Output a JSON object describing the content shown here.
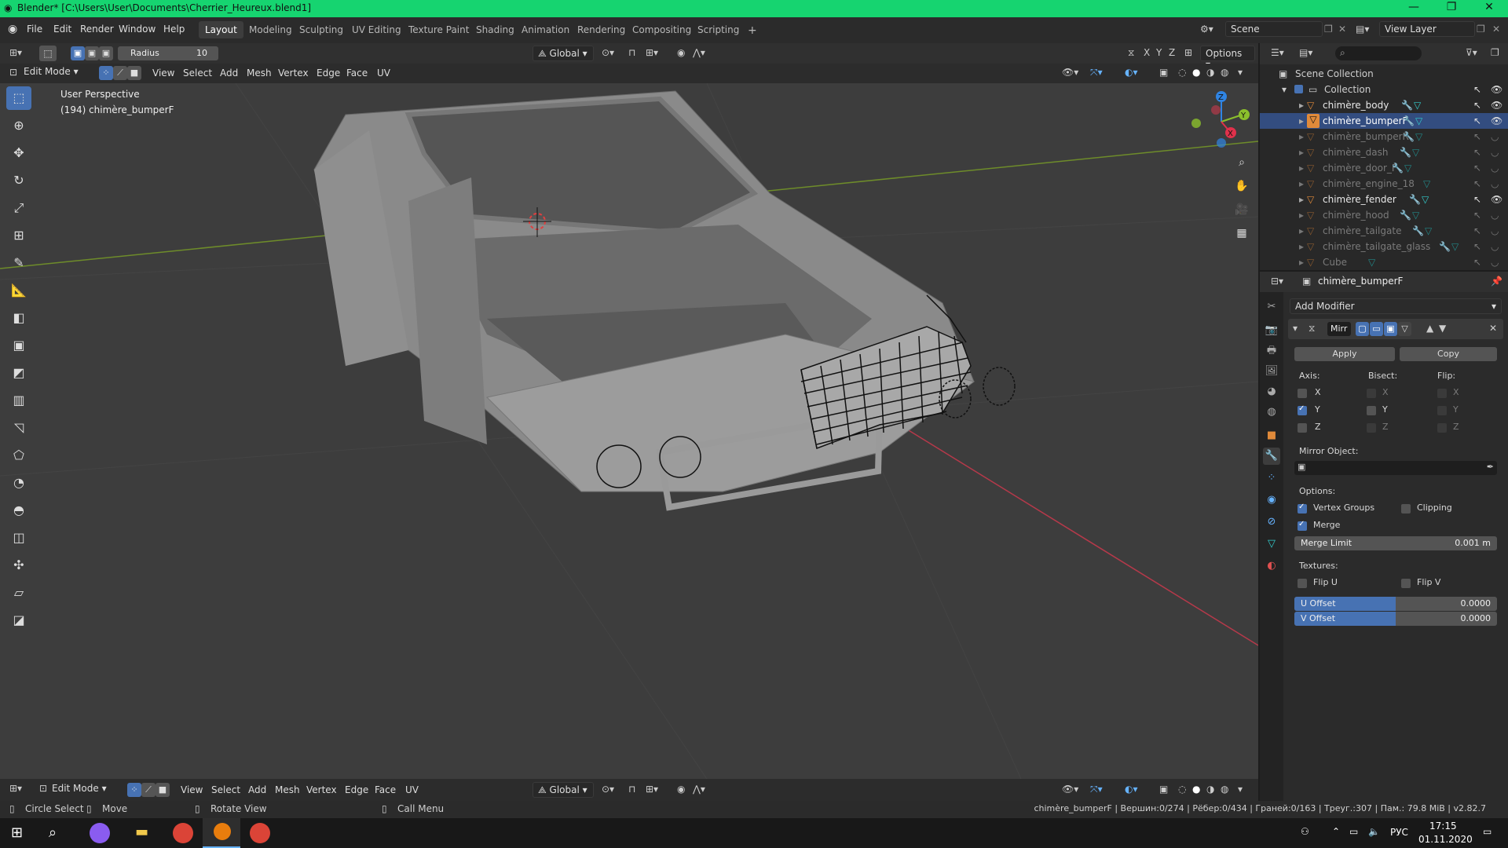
{
  "titlebar": {
    "title": "Blender* [C:\\Users\\User\\Documents\\Cherrier_Heureux.blend1]",
    "minimize": "—",
    "restore": "❐",
    "close": "✕"
  },
  "menu": [
    "File",
    "Edit",
    "Render",
    "Window",
    "Help"
  ],
  "workspaces": [
    "Layout",
    "Modeling",
    "Sculpting",
    "UV Editing",
    "Texture Paint",
    "Shading",
    "Animation",
    "Rendering",
    "Compositing",
    "Scripting"
  ],
  "workspace_add": "+",
  "scene": {
    "label": "Scene",
    "view_layer": "View Layer"
  },
  "tool_header": {
    "radius_label": "Radius",
    "radius_value": "10",
    "orientation": "Global",
    "axes": [
      "X",
      "Y",
      "Z"
    ],
    "options": "Options"
  },
  "viewport_header": {
    "mode": "Edit Mode",
    "menus": [
      "View",
      "Select",
      "Add",
      "Mesh",
      "Vertex",
      "Edge",
      "Face",
      "UV"
    ]
  },
  "viewport_info": {
    "perspective": "User Perspective",
    "object": "(194) chimère_bumperF"
  },
  "gizmo": {
    "x": "X",
    "y": "Y",
    "z": "Z"
  },
  "bottom_header": {
    "mode": "Edit Mode",
    "menus": [
      "View",
      "Select",
      "Add",
      "Mesh",
      "Vertex",
      "Edge",
      "Face",
      "UV"
    ],
    "orientation": "Global"
  },
  "statusbar": {
    "left": [
      {
        "icon": "mouse-left-icon",
        "label": "Circle Select"
      },
      {
        "icon": "mouse-move-icon",
        "label": "Move"
      },
      {
        "icon": "mouse-middle-icon",
        "label": "Rotate View"
      },
      {
        "icon": "mouse-right-icon",
        "label": "Call Menu"
      }
    ],
    "stats": "chimère_bumperF | Вершин:0/274 | Рёбер:0/434 | Граней:0/163 | Треуг.:307 | Пам.: 79.8 MiB | v2.82.7"
  },
  "outliner": {
    "scene_collection": "Scene Collection",
    "collection": "Collection",
    "items": [
      {
        "name": "chimère_body",
        "active": false,
        "visible": true
      },
      {
        "name": "chimère_bumperF",
        "active": true,
        "visible": true
      },
      {
        "name": "chimère_bumperR",
        "active": false,
        "visible": false
      },
      {
        "name": "chimère_dash",
        "active": false,
        "visible": false
      },
      {
        "name": "chimère_door_F",
        "active": false,
        "visible": false
      },
      {
        "name": "chimère_engine_18",
        "active": false,
        "visible": false
      },
      {
        "name": "chimère_fender",
        "active": false,
        "visible": true
      },
      {
        "name": "chimère_hood",
        "active": false,
        "visible": false
      },
      {
        "name": "chimère_tailgate",
        "active": false,
        "visible": false
      },
      {
        "name": "chimère_tailgate_glass",
        "active": false,
        "visible": false
      },
      {
        "name": "Cube",
        "active": false,
        "visible": false
      }
    ]
  },
  "properties": {
    "object": "chimère_bumperF",
    "add_modifier": "Add Modifier",
    "modifier_name": "Mirr",
    "apply": "Apply",
    "copy": "Copy",
    "axis_label": "Axis:",
    "bisect_label": "Bisect:",
    "flip_label": "Flip:",
    "axes": [
      {
        "label": "X",
        "checked": false
      },
      {
        "label": "Y",
        "checked": true
      },
      {
        "label": "Z",
        "checked": false
      }
    ],
    "mirror_object_label": "Mirror Object:",
    "options_label": "Options:",
    "vertex_groups": "Vertex Groups",
    "clipping": "Clipping",
    "merge": "Merge",
    "merge_limit_label": "Merge Limit",
    "merge_limit_value": "0.001 m",
    "textures_label": "Textures:",
    "flip_u": "Flip U",
    "flip_v": "Flip V",
    "u_offset_label": "U Offset",
    "u_offset_value": "0.0000",
    "v_offset_label": "V Offset",
    "v_offset_value": "0.0000"
  },
  "taskbar": {
    "time": "17:15",
    "date": "01.11.2020",
    "lang": "РУС"
  },
  "colors": {
    "titlebar": "#16d470",
    "accent": "#4772b3",
    "viewport": "#3d3d3d",
    "x_axis": "#e0314b",
    "y_axis": "#8bbf2c",
    "z_axis": "#2f84e3"
  }
}
